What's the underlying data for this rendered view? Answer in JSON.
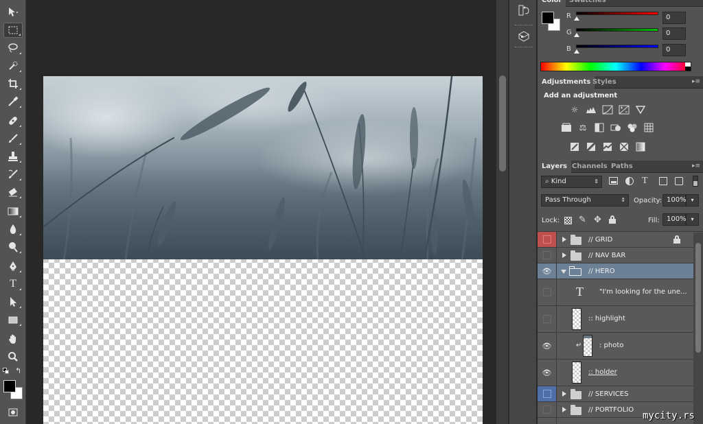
{
  "toolbar": {
    "tools": [
      {
        "name": "move-tool-icon"
      },
      {
        "name": "marquee-tool-icon",
        "active": true
      },
      {
        "name": "lasso-tool-icon"
      },
      {
        "name": "quick-selection-tool-icon"
      },
      {
        "name": "crop-tool-icon"
      },
      {
        "name": "eyedropper-tool-icon"
      },
      {
        "name": "healing-brush-tool-icon"
      },
      {
        "name": "brush-tool-icon"
      },
      {
        "name": "clone-stamp-tool-icon"
      },
      {
        "name": "history-brush-tool-icon"
      },
      {
        "name": "eraser-tool-icon"
      },
      {
        "name": "gradient-tool-icon"
      },
      {
        "name": "blur-tool-icon"
      },
      {
        "name": "dodge-tool-icon"
      },
      {
        "name": "pen-tool-icon"
      },
      {
        "name": "type-tool-icon",
        "glyph": "T"
      },
      {
        "name": "path-selection-tool-icon"
      },
      {
        "name": "rectangle-tool-icon"
      },
      {
        "name": "hand-tool-icon"
      },
      {
        "name": "zoom-tool-icon"
      }
    ],
    "foreground_color": "#000000",
    "background_color": "#ffffff"
  },
  "color_panel": {
    "tabs": [
      "Color",
      "Swatches"
    ],
    "channels": [
      {
        "label": "R",
        "value": "0",
        "color": "#ff0000"
      },
      {
        "label": "G",
        "value": "0",
        "color": "#00c000"
      },
      {
        "label": "B",
        "value": "0",
        "color": "#0000ff"
      }
    ]
  },
  "adjustments_panel": {
    "tabs": [
      "Adjustments",
      "Styles"
    ],
    "title": "Add an adjustment"
  },
  "layers_panel": {
    "tabs": [
      "Layers",
      "Channels",
      "Paths"
    ],
    "filter_kind": "Kind",
    "blend_mode": "Pass Through",
    "opacity_label": "Opacity:",
    "opacity_value": "100%",
    "lock_label": "Lock:",
    "fill_label": "Fill:",
    "fill_value": "100%",
    "layers": [
      {
        "name": "// GRID",
        "type": "group",
        "color_label": "#c0504d",
        "visible": false,
        "locked": true
      },
      {
        "name": "// NAV BAR",
        "type": "group",
        "visible": false
      },
      {
        "name": "// HERO",
        "type": "group",
        "visible": true,
        "expanded": true,
        "selected": true
      },
      {
        "name": "\"I'm looking for the une...",
        "type": "text",
        "visible": false
      },
      {
        "name": ":: highlight",
        "type": "layer",
        "visible": false
      },
      {
        "name": ": photo",
        "type": "layer",
        "visible": true,
        "clipped": true
      },
      {
        "name": ":: holder",
        "type": "layer",
        "visible": true
      },
      {
        "name": "// SERVICES",
        "type": "group",
        "color_label": "#4f6fa8",
        "visible": false
      },
      {
        "name": "// PORTFOLIO",
        "type": "group",
        "visible": false
      }
    ]
  },
  "watermark": "mycity.rs"
}
